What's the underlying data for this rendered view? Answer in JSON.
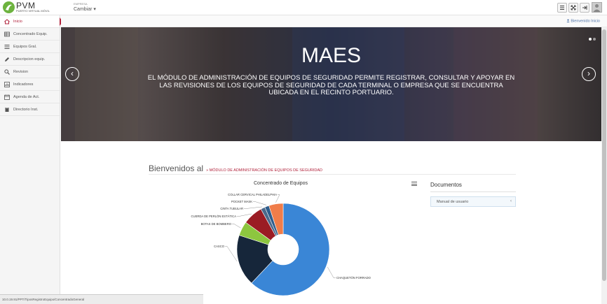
{
  "app": {
    "logo_title": "PVM",
    "logo_subtitle": "PUERTO VIRTUAL MÓVIL",
    "empresa_label": "EMPRESA",
    "empresa_value": "Cambiar ▾"
  },
  "topbar_buttons": [
    "menu-icon",
    "expand-icon",
    "logout-icon",
    "user-icon"
  ],
  "sidebar": {
    "items": [
      {
        "label": "Inicio",
        "icon": "home-icon",
        "active": true
      },
      {
        "label": "Concentrado Equip.",
        "icon": "table-icon",
        "active": false
      },
      {
        "label": "Equipos Gral.",
        "icon": "list-icon",
        "active": false
      },
      {
        "label": "Descripcion equip.",
        "icon": "pencil-icon",
        "active": false
      },
      {
        "label": "Revision",
        "icon": "search-icon",
        "active": false
      },
      {
        "label": "Indicadores",
        "icon": "chart-icon",
        "active": false
      },
      {
        "label": "Agenda de Act.",
        "icon": "calendar-icon",
        "active": false
      },
      {
        "label": "Directorio Inst.",
        "icon": "book-icon",
        "active": false
      }
    ]
  },
  "header": {
    "bienvenido_link": "Bienvenido Inicio"
  },
  "carousel": {
    "title": "MAES",
    "text": "EL MÓDULO DE ADMINISTRACIÓN DE EQUIPOS DE SEGURIDAD PERMITE REGISTRAR, CONSULTAR Y APOYAR EN LAS REVISIONES DE LOS EQUIPOS DE SEGURIDAD DE CADA TERMINAL O EMPRESA QUE SE ENCUENTRA UBICADA EN EL RECINTO PORTUARIO.",
    "prev": "‹",
    "next": "›"
  },
  "welcome": {
    "big": "Bienvenidos al",
    "small": "» MÓDULO DE ADMINISTRACIÓN DE EQUIPOS DE SEGURIDAD"
  },
  "documents": {
    "title": "Documentos",
    "items": [
      {
        "label": "Manual de usuario",
        "chevron": "‹"
      }
    ]
  },
  "statusbar": {
    "text": "10.0.19.91/PPT/TiposRegistroEquipo/ConcentradoGeneral"
  },
  "chart_data": {
    "type": "pie",
    "title": "Concentrado de Equipos",
    "donut": true,
    "slices": [
      {
        "label": "CHAQUETÓN FORRADO",
        "value": 62.0,
        "color": "#3a86d6"
      },
      {
        "label": "CASCO",
        "value": 18.0,
        "color": "#16263a"
      },
      {
        "label": "BOTAS DE BOMBERO",
        "value": 5.0,
        "color": "#8dc63f"
      },
      {
        "label": "CUERDA DE PERLÓN ESTÁTICA",
        "value": 7.0,
        "color": "#9b1c24"
      },
      {
        "label": "CINTA TUBULAR",
        "value": 1.5,
        "color": "#4b6a8c"
      },
      {
        "label": "POCKET MASK",
        "value": 1.5,
        "color": "#2f5d8c"
      },
      {
        "label": "COLLAR CERVICAL PHILADELPHIA",
        "value": 5.0,
        "color": "#f07d4a"
      }
    ]
  }
}
